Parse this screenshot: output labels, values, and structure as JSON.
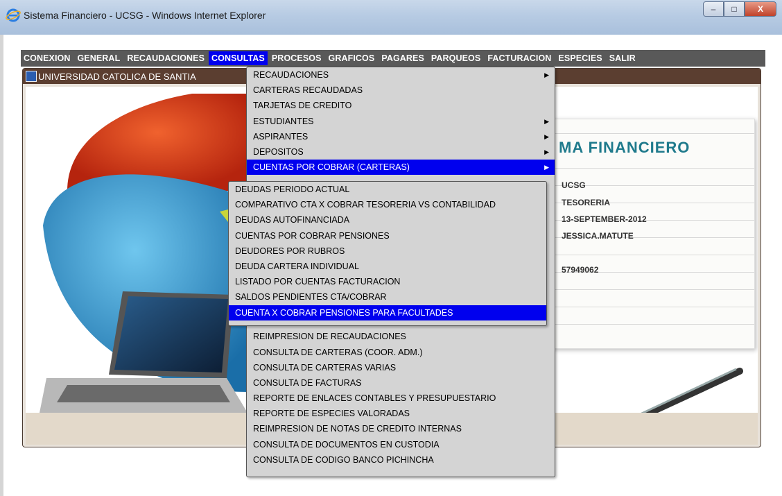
{
  "window": {
    "title": "Sistema Financiero - UCSG - Windows Internet Explorer",
    "minimize": "–",
    "maximize": "□",
    "close": "X"
  },
  "menubar": {
    "items": [
      {
        "label": "CONEXION",
        "active": false
      },
      {
        "label": "GENERAL",
        "active": false
      },
      {
        "label": "RECAUDACIONES",
        "active": false
      },
      {
        "label": "CONSULTAS",
        "active": true
      },
      {
        "label": "PROCESOS",
        "active": false
      },
      {
        "label": "GRAFICOS",
        "active": false
      },
      {
        "label": "PAGARES",
        "active": false
      },
      {
        "label": "PARQUEOS",
        "active": false
      },
      {
        "label": "FACTURACION",
        "active": false
      },
      {
        "label": "ESPECIES",
        "active": false
      },
      {
        "label": "SALIR",
        "active": false
      }
    ]
  },
  "mdi": {
    "title": "UNIVERSIDAD CATOLICA DE SANTIA"
  },
  "info_panel": {
    "title": "MA  FINANCIERO",
    "values": [
      "UCSG",
      "TESORERIA",
      "13-SEPTEMBER-2012",
      "JESSICA.MATUTE",
      "57949062"
    ]
  },
  "consultas_menu": {
    "items": [
      {
        "label": "RECAUDACIONES",
        "submenu": true,
        "highlight": false
      },
      {
        "label": "CARTERAS RECAUDADAS",
        "submenu": false,
        "highlight": false
      },
      {
        "label": "TARJETAS DE CREDITO",
        "submenu": false,
        "highlight": false
      },
      {
        "label": "ESTUDIANTES",
        "submenu": true,
        "highlight": false
      },
      {
        "label": "ASPIRANTES",
        "submenu": true,
        "highlight": false
      },
      {
        "label": "DEPOSITOS",
        "submenu": true,
        "highlight": false
      },
      {
        "label": "CUENTAS POR COBRAR (CARTERAS)",
        "submenu": true,
        "highlight": true
      }
    ],
    "lower_items": [
      {
        "label": "REIMPRESION DE RECAUDACIONES"
      },
      {
        "label": "CONSULTA DE CARTERAS (COOR. ADM.)"
      },
      {
        "label": "CONSULTA DE CARTERAS VARIAS"
      },
      {
        "label": "CONSULTA DE FACTURAS"
      },
      {
        "label": "REPORTE DE ENLACES CONTABLES Y PRESUPUESTARIO"
      },
      {
        "label": "REPORTE DE ESPECIES VALORADAS"
      },
      {
        "label": "REIMPRESION DE NOTAS DE CREDITO INTERNAS"
      },
      {
        "label": "CONSULTA DE DOCUMENTOS EN CUSTODIA"
      },
      {
        "label": "CONSULTA DE CODIGO BANCO PICHINCHA"
      }
    ]
  },
  "cuentas_submenu": {
    "items": [
      {
        "label": "DEUDAS PERIODO ACTUAL",
        "highlight": false
      },
      {
        "label": "COMPARATIVO CTA X COBRAR TESORERIA VS CONTABILIDAD",
        "highlight": false
      },
      {
        "label": "DEUDAS AUTOFINANCIADA",
        "highlight": false
      },
      {
        "label": "CUENTAS POR COBRAR PENSIONES",
        "highlight": false
      },
      {
        "label": "DEUDORES POR RUBROS",
        "highlight": false
      },
      {
        "label": "DEUDA CARTERA INDIVIDUAL",
        "highlight": false
      },
      {
        "label": "LISTADO POR CUENTAS FACTURACION",
        "highlight": false
      },
      {
        "label": "SALDOS PENDIENTES CTA/COBRAR",
        "highlight": false
      },
      {
        "label": "CUENTA X COBRAR PENSIONES PARA FACULTADES",
        "highlight": true
      }
    ]
  },
  "icons": [
    "ie-logo-icon",
    "app-window-icon",
    "submenu-arrow-icon"
  ]
}
